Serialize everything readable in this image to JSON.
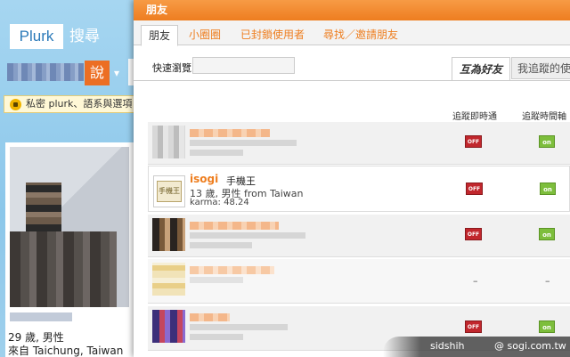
{
  "background": {
    "logo": "Plurk",
    "search_link": "搜尋",
    "say_button": "說",
    "say_arrow": "▾",
    "privacy_text": "私密 plurk、語系與選項",
    "profile": {
      "age_gender": "29 歲, 男性",
      "from": "來自 Taichung, Taiwan"
    }
  },
  "dialog": {
    "title": "朋友",
    "tabs": [
      {
        "label": "朋友",
        "active": true
      },
      {
        "label": "小圈圈"
      },
      {
        "label": "已封鎖使用者"
      },
      {
        "label": "尋找／邀請朋友"
      }
    ],
    "quick_search_label": "快速瀏覽:",
    "quick_search_value": "",
    "subtabs": {
      "mutual": "互為好友",
      "following": "我追蹤的使"
    },
    "columns": {
      "realtime": "追蹤即時通",
      "timeline": "追蹤時間軸"
    },
    "rows": [
      {
        "realtime": "OFF",
        "timeline": "on"
      },
      {
        "name": "isogi",
        "title": "手機王",
        "description": "13 歲, 男性 from Taiwan",
        "karma": "karma: 48.24",
        "realtime": "OFF",
        "timeline": "on"
      },
      {
        "realtime": "OFF",
        "timeline": "on"
      },
      {
        "realtime": "–",
        "timeline": "–"
      },
      {
        "realtime": "OFF",
        "timeline": "on"
      }
    ]
  },
  "watermark": {
    "author": "sidshih",
    "site": "@ sogi.com.tw"
  },
  "colors": {
    "accent_orange": "#ee7e1f",
    "off_red": "#c1272d",
    "on_green": "#7dbe3c",
    "plurk_blue": "#9fd0ec"
  }
}
